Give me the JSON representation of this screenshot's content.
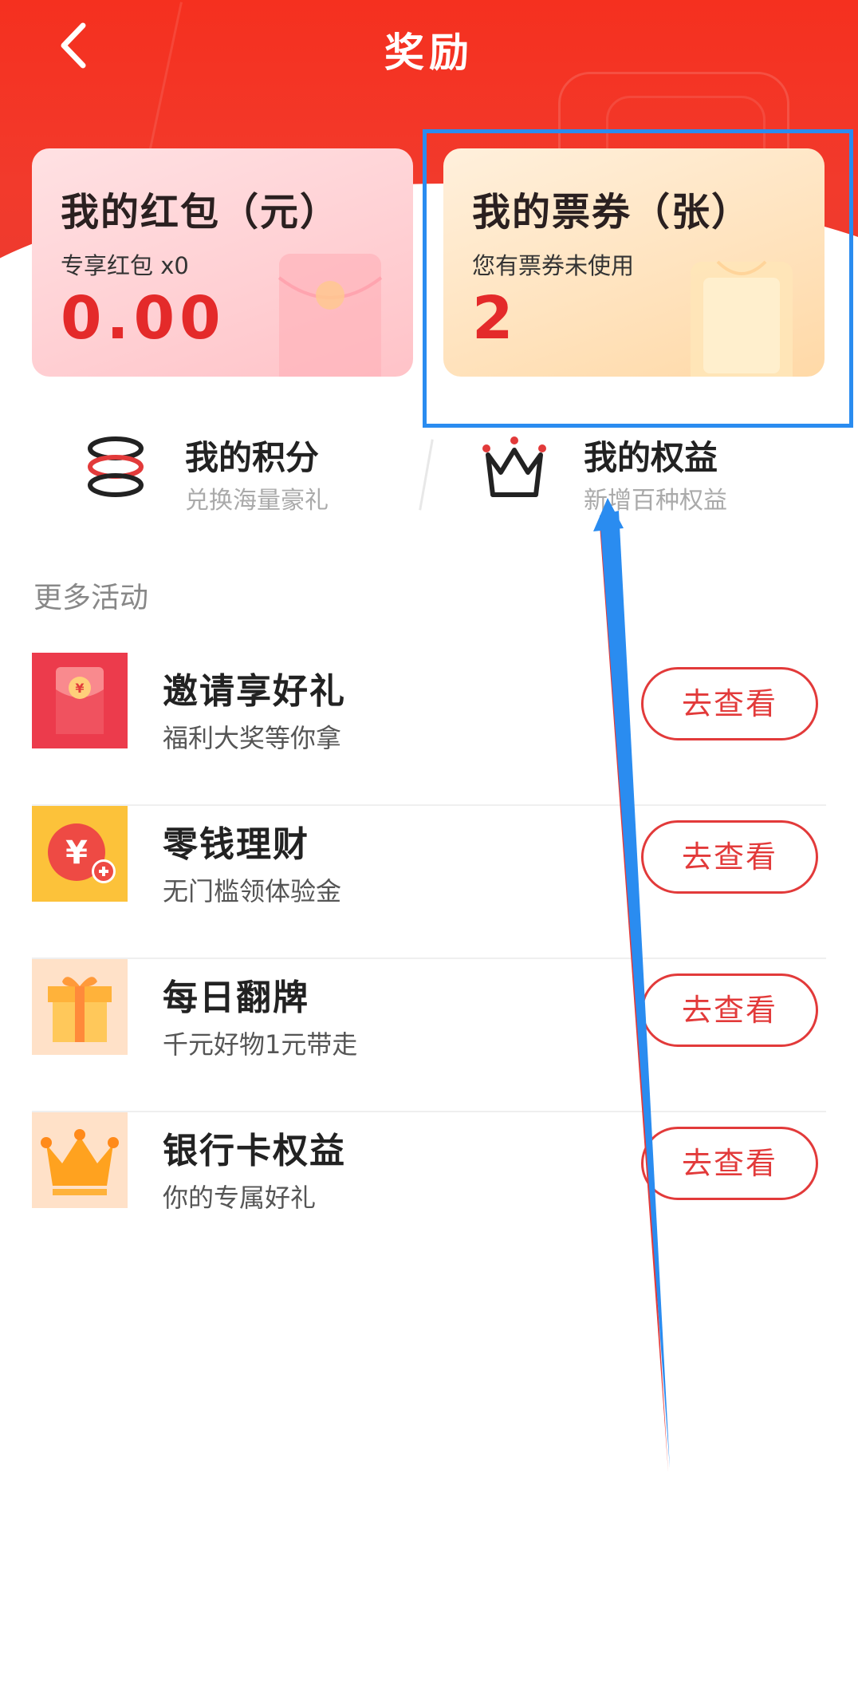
{
  "header": {
    "title": "奖励"
  },
  "cards": {
    "red_packet": {
      "title": "我的红包（元）",
      "subtitle": "专享红包 x0",
      "value": "0.00"
    },
    "tickets": {
      "title": "我的票券（张）",
      "subtitle": "您有票券未使用",
      "value": "2"
    }
  },
  "features": {
    "points": {
      "title": "我的积分",
      "subtitle": "兑换海量豪礼"
    },
    "rights": {
      "title": "我的权益",
      "subtitle": "新增百种权益"
    }
  },
  "more": {
    "section_title": "更多活动",
    "items": [
      {
        "title": "邀请享好礼",
        "subtitle": "福利大奖等你拿",
        "button": "去查看",
        "icon": "red-envelope-icon"
      },
      {
        "title": "零钱理财",
        "subtitle": "无门槛领体验金",
        "button": "去查看",
        "icon": "coin-plus-icon"
      },
      {
        "title": "每日翻牌",
        "subtitle": "千元好物1元带走",
        "button": "去查看",
        "icon": "gift-box-icon"
      },
      {
        "title": "银行卡权益",
        "subtitle": "你的专属好礼",
        "button": "去查看",
        "icon": "crown-icon"
      }
    ]
  },
  "colors": {
    "brand_red": "#f5301f",
    "accent_red": "#e42a2a",
    "highlight_blue": "#2a8cf0"
  }
}
